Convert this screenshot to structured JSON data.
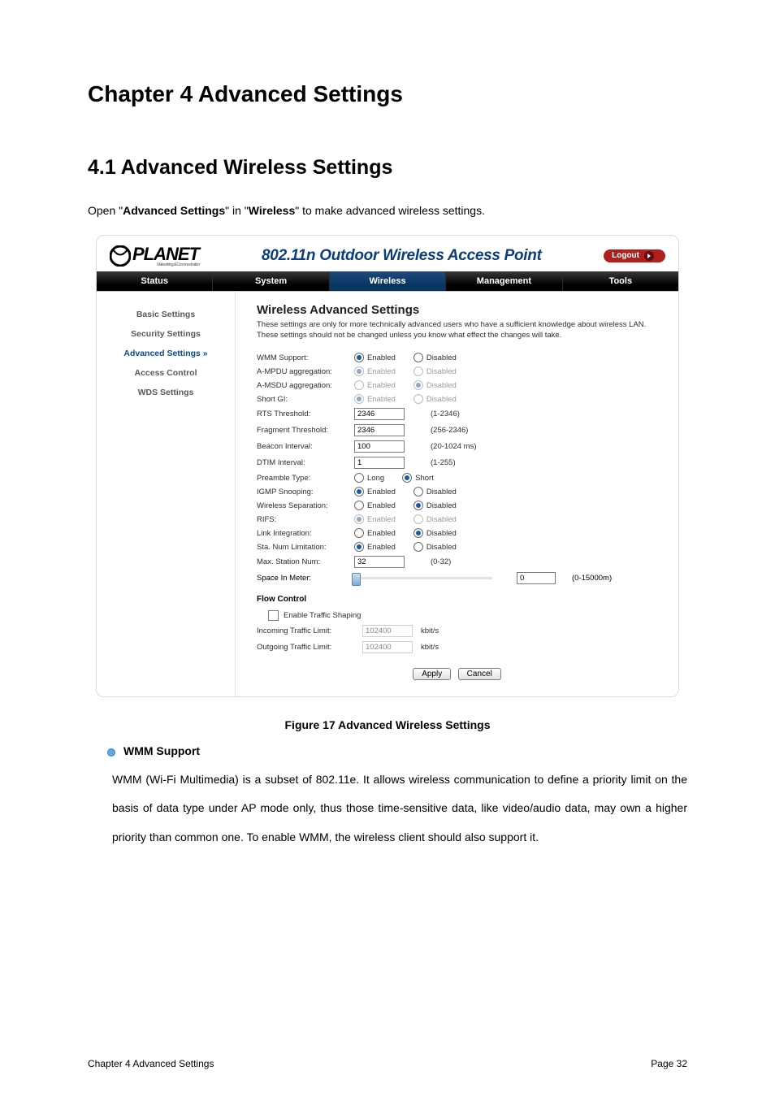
{
  "chapter": {
    "title": "Chapter 4 Advanced Settings",
    "section_title": "4.1 Advanced Wireless Settings",
    "intro_pre": "Open \"",
    "intro_b1": "Advanced Settings",
    "intro_mid": "\" in \"",
    "intro_b2": "Wireless",
    "intro_post": "\" to make advanced wireless settings."
  },
  "screenshot": {
    "logo_text": "PLANET",
    "logo_sub": "Networking & Communication",
    "title": "802.11n Outdoor Wireless Access Point",
    "logout": "Logout",
    "nav": {
      "status": "Status",
      "system": "System",
      "wireless": "Wireless",
      "management": "Management",
      "tools": "Tools"
    },
    "side": {
      "basic": "Basic Settings",
      "security": "Security Settings",
      "advanced": "Advanced Settings  »",
      "access": "Access Control",
      "wds": "WDS Settings"
    },
    "main": {
      "heading": "Wireless Advanced Settings",
      "desc": "These settings are only for more technically advanced users who have a sufficient knowledge about wireless LAN. These settings should not be changed unless you know what effect the changes will take.",
      "labels": {
        "wmm": "WMM Support:",
        "ampdu": "A-MPDU aggregation:",
        "amsdu": "A-MSDU aggregation:",
        "shortgi": "Short GI:",
        "rts": "RTS Threshold:",
        "frag": "Fragment Threshold:",
        "beacon": "Beacon Interval:",
        "dtim": "DTIM Interval:",
        "preamble": "Preamble Type:",
        "igmp": "IGMP Snooping:",
        "sep": "Wireless Separation:",
        "rifs": "RIFS:",
        "link": "Link Integration:",
        "stalimit": "Sta. Num Limitation:",
        "maxsta": "Max. Station Num:",
        "space": "Space In Meter:"
      },
      "radio": {
        "enabled": "Enabled",
        "disabled": "Disabled",
        "long": "Long",
        "short": "Short"
      },
      "values": {
        "rts": "2346",
        "frag": "2346",
        "beacon": "100",
        "dtim": "1",
        "maxsta": "32",
        "space": "0"
      },
      "hints": {
        "rts": "(1-2346)",
        "frag": "(256-2346)",
        "beacon": "(20-1024 ms)",
        "dtim": "(1-255)",
        "maxsta": "(0-32)",
        "space": "(0-15000m)"
      },
      "flow": {
        "heading": "Flow Control",
        "enable": "Enable Traffic Shaping",
        "in_label": "Incoming Traffic Limit:",
        "out_label": "Outgoing Traffic Limit:",
        "in_val": "102400",
        "out_val": "102400",
        "unit": "kbit/s"
      },
      "buttons": {
        "apply": "Apply",
        "cancel": "Cancel"
      }
    }
  },
  "figure_caption": "Figure 17 Advanced Wireless Settings",
  "bullet_heading": "WMM Support",
  "paragraph": "WMM (Wi-Fi Multimedia) is a subset of 802.11e. It allows wireless communication to define a priority limit on the basis of data type under AP mode only, thus those time-sensitive data, like video/audio data, may own a higher priority than common one.  To enable WMM, the wireless client should also support it.",
  "footer": {
    "left": "Chapter 4 Advanced Settings",
    "right": "Page 32"
  }
}
